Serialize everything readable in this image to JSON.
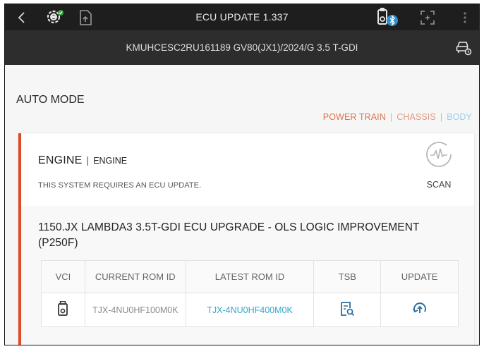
{
  "topbar": {
    "title": "ECU UPDATE 1.337",
    "icons": [
      "back-icon",
      "vehicle-gear-icon",
      "file-upload-icon",
      "vci-bluetooth-icon",
      "scan-frame-icon",
      "more-vertical-icon"
    ]
  },
  "vehicle": {
    "info": "KMUHCESC2RU161189  GV80(JX1)/2024/G 3.5 T-GDI"
  },
  "mode": {
    "label": "AUTO MODE"
  },
  "filters": {
    "power_train": "POWER TRAIN",
    "chassis": "CHASSIS",
    "body": "BODY"
  },
  "system": {
    "name": "ENGINE",
    "sub": "ENGINE",
    "message": "THIS SYSTEM REQUIRES AN ECU UPDATE.",
    "scan_label": "SCAN"
  },
  "update": {
    "title": "1150.JX LAMBDA3 3.5T-GDI ECU UPGRADE - OLS LOGIC IMPROVEMENT (P250F)",
    "columns": [
      "VCI",
      "CURRENT ROM ID",
      "LATEST ROM ID",
      "TSB",
      "UPDATE"
    ],
    "row": {
      "current_rom": "TJX-4NU0HF100M0K",
      "latest_rom": "TJX-4NU0HF400M0K"
    }
  },
  "colors": {
    "accent_red": "#e04a2b",
    "power_train": "#e0734f",
    "chassis": "#e29b85",
    "body": "#9ccfe4",
    "latest_rom": "#33a7c9"
  }
}
